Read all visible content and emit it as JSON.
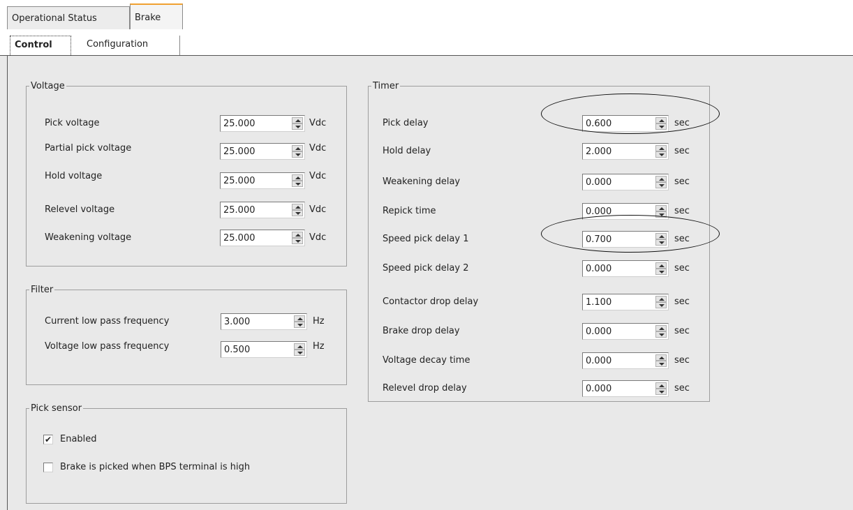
{
  "tabs": [
    {
      "label": "Operational Status"
    },
    {
      "label": "Brake"
    }
  ],
  "subtabs": [
    {
      "label": "Control"
    },
    {
      "label": "Configuration"
    }
  ],
  "voltage": {
    "title": "Voltage",
    "unit": "Vdc",
    "rows": [
      {
        "label": "Pick voltage",
        "value": "25.000"
      },
      {
        "label": "Partial pick voltage",
        "value": "25.000"
      },
      {
        "label": "Hold voltage",
        "value": "25.000"
      },
      {
        "label": "Relevel voltage",
        "value": "25.000"
      },
      {
        "label": "Weakening voltage",
        "value": "25.000"
      }
    ]
  },
  "filter": {
    "title": "Filter",
    "unit": "Hz",
    "rows": [
      {
        "label": "Current low pass frequency",
        "value": "3.000"
      },
      {
        "label": "Voltage low pass frequency",
        "value": "0.500"
      }
    ]
  },
  "pick_sensor": {
    "title": "Pick sensor",
    "checks": [
      {
        "label": "Enabled",
        "checked": true,
        "mark": "✔"
      },
      {
        "label": "Brake is picked when BPS terminal is high",
        "checked": false,
        "mark": ""
      }
    ]
  },
  "timer": {
    "title": "Timer",
    "unit": "sec",
    "rows": [
      {
        "label": "Pick delay",
        "value": "0.600"
      },
      {
        "label": "Hold delay",
        "value": "2.000"
      },
      {
        "label": "Weakening delay",
        "value": "0.000"
      },
      {
        "label": "Repick time",
        "value": "0.000"
      },
      {
        "label": "Speed pick delay 1",
        "value": "0.700"
      },
      {
        "label": "Speed pick delay 2",
        "value": "0.000"
      },
      {
        "label": "Contactor drop delay",
        "value": "1.100"
      },
      {
        "label": "Brake drop delay",
        "value": "0.000"
      },
      {
        "label": "Voltage decay time",
        "value": "0.000"
      },
      {
        "label": "Relevel drop delay",
        "value": "0.000"
      }
    ]
  }
}
